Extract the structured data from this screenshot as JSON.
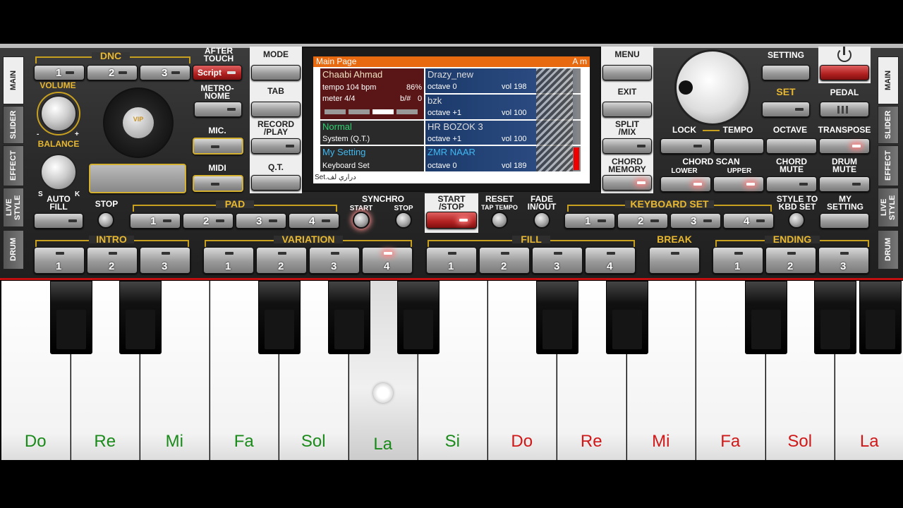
{
  "left_tabs": [
    "MAIN",
    "SLIDER",
    "EFFECT",
    "LIVE STYLE",
    "DRUM"
  ],
  "right_tabs": [
    "MAIN",
    "SLIDER",
    "EFFECT",
    "LIVE STYLE",
    "DRUM"
  ],
  "dnc": {
    "label": "DNC",
    "buttons": [
      "1",
      "2",
      "3"
    ],
    "script_label": "Script"
  },
  "after_touch_label": "AFTER\nTOUCH",
  "volume_label": "VOLUME",
  "balance_label": "BALANCE",
  "balance_minus": "-",
  "balance_plus": "+",
  "auto_fill_label": "AUTO\nFILL",
  "s_label": "S",
  "k_label": "K",
  "metronome_label": "METRO-\nNOME",
  "mic_label": "MIC.",
  "midi_label": "MIDI",
  "vip_label": "VIP",
  "center_left": {
    "mode": "MODE",
    "tab": "TAB",
    "record_play": "RECORD\n/PLAY",
    "qt": "Q.T."
  },
  "center_right": {
    "menu": "MENU",
    "exit": "EXIT",
    "split_mix": "SPLIT\n/MIX",
    "chord_memory": "CHORD\nMEMORY"
  },
  "lcd": {
    "title": "Main Page",
    "chord": "A m",
    "left_side_labels": [
      "S",
      "T",
      "Y",
      "L",
      "E",
      "S",
      "Y",
      "S",
      "K",
      "B",
      "D"
    ],
    "right_side_labels": [
      "U",
      "P",
      "1",
      "U",
      "P",
      "2",
      "U",
      "P",
      "3",
      "L",
      "o",
      "w"
    ],
    "style": {
      "name": "Chaabi Ahmad",
      "tempo": "tempo 104 bpm",
      "percent": "86%",
      "meter": "meter 4/4",
      "bsharp": "b/#",
      "bsharp_val": "0"
    },
    "system": {
      "name": "Normal",
      "sub": "System (Q.T.)"
    },
    "kbd": {
      "name": "My Setting",
      "sub": "Keyboard Set"
    },
    "footer": "Set.دراري لف",
    "parts": [
      {
        "name": "Drazy_new",
        "octave": "octave  0",
        "vol": "vol 198"
      },
      {
        "name": "bzk",
        "octave": "octave +1",
        "vol": "vol 100"
      },
      {
        "name": "HR BOZOK 3",
        "octave": "octave +1",
        "vol": "vol 100"
      },
      {
        "name": "ZMR NAAR",
        "octave": "octave  0",
        "vol": "vol 189"
      }
    ]
  },
  "setting_label": "SETTING",
  "set_label": "SET",
  "pedal_label": "PEDAL",
  "lock_label": "LOCK",
  "tempo_label": "TEMPO",
  "octave_label": "OCTAVE",
  "transpose_label": "TRANSPOSE",
  "chord_scan_label": "CHORD SCAN",
  "lower_label": "LOWER",
  "upper_label": "UPPER",
  "chord_mute_label": "CHORD\nMUTE",
  "drum_mute_label": "DRUM\nMUTE",
  "stop_label": "STOP",
  "pad": {
    "label": "PAD",
    "buttons": [
      "1",
      "2",
      "3",
      "4"
    ]
  },
  "synchro": {
    "label": "SYNCHRO",
    "start": "START",
    "stop": "STOP"
  },
  "start_stop_label": "START\n/STOP",
  "reset_label": "RESET",
  "tap_tempo_label": "TAP TEMPO",
  "fade_label": "FADE\nIN/OUT",
  "keyboard_set": {
    "label": "KEYBOARD SET",
    "buttons": [
      "1",
      "2",
      "3",
      "4"
    ]
  },
  "style_to_kbd_label": "STYLE TO\nKBD SET",
  "my_setting_label": "MY\nSETTING",
  "intro": {
    "label": "INTRO",
    "buttons": [
      "1",
      "2",
      "3"
    ]
  },
  "variation": {
    "label": "VARIATION",
    "buttons": [
      "1",
      "2",
      "3",
      "4"
    ]
  },
  "fill": {
    "label": "FILL",
    "buttons": [
      "1",
      "2",
      "3",
      "4"
    ]
  },
  "break_label": "BREAK",
  "ending": {
    "label": "ENDING",
    "buttons": [
      "1",
      "2",
      "3"
    ]
  },
  "keys": [
    {
      "note": "Do",
      "color": "#1a8a1a"
    },
    {
      "note": "Re",
      "color": "#1a8a1a"
    },
    {
      "note": "Mi",
      "color": "#1a8a1a"
    },
    {
      "note": "Fa",
      "color": "#1a8a1a"
    },
    {
      "note": "Sol",
      "color": "#1a8a1a"
    },
    {
      "note": "La",
      "color": "#1a8a1a",
      "pressed": true
    },
    {
      "note": "Si",
      "color": "#1a8a1a"
    },
    {
      "note": "Do",
      "color": "#d01818"
    },
    {
      "note": "Re",
      "color": "#d01818"
    },
    {
      "note": "Mi",
      "color": "#d01818"
    },
    {
      "note": "Fa",
      "color": "#d01818"
    },
    {
      "note": "Sol",
      "color": "#d01818"
    },
    {
      "note": "La",
      "color": "#d01818"
    }
  ]
}
